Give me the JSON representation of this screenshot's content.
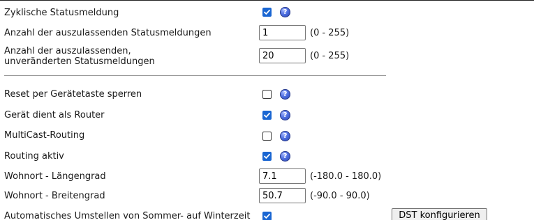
{
  "settings": {
    "cyclic_status": {
      "label": "Zyklische Statusmeldung",
      "checked": true
    },
    "skip_status": {
      "label": "Anzahl der auszulassenden Statusmeldungen",
      "value": "1",
      "range": "(0 - 255)"
    },
    "skip_unchanged": {
      "label": "Anzahl der auszulassenden,\nunveränderten Statusmeldungen",
      "value": "20",
      "range": "(0 - 255)"
    },
    "reset_lock": {
      "label": "Reset per Gerätetaste sperren",
      "checked": false
    },
    "router": {
      "label": "Gerät dient als Router",
      "checked": true
    },
    "multicast": {
      "label": "MultiCast-Routing",
      "checked": false
    },
    "routing_active": {
      "label": "Routing aktiv",
      "checked": true
    },
    "longitude": {
      "label": "Wohnort - Längengrad",
      "value": "7.1",
      "range": "(-180.0 - 180.0)"
    },
    "latitude": {
      "label": "Wohnort - Breitengrad",
      "value": "50.7",
      "range": "(-90.0 - 90.0)"
    },
    "dst": {
      "label": "Automatisches Umstellen von Sommer- auf Winterzeit",
      "checked": true,
      "button_label": "DST konfigurieren"
    }
  },
  "icons": {
    "help": "help-icon",
    "help_glyph": "?",
    "checkmark": "checkmark-icon"
  },
  "colors": {
    "checkbox_checked": "#1a66d2",
    "help_icon": "#4d6ee0"
  }
}
